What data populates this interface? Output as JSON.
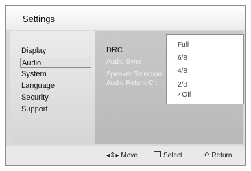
{
  "header": {
    "title": "Settings"
  },
  "sidebar": {
    "items": [
      {
        "label": "Display",
        "selected": false
      },
      {
        "label": "Audio",
        "selected": true
      },
      {
        "label": "System",
        "selected": false
      },
      {
        "label": "Language",
        "selected": false
      },
      {
        "label": "Security",
        "selected": false
      },
      {
        "label": "Support",
        "selected": false
      }
    ]
  },
  "submenu": {
    "items": [
      {
        "label": "DRC",
        "active": true
      },
      {
        "label": "Audio Sync",
        "active": false
      },
      {
        "label": "Speaker Selection",
        "active": false
      },
      {
        "label": "Audio Return Ch.",
        "active": false
      }
    ]
  },
  "drc_options": {
    "items": [
      "Full",
      "6/8",
      "4/8",
      "2/8",
      "Off"
    ],
    "checked": "Off",
    "check_glyph": "✓"
  },
  "footer": {
    "move_label": "Move",
    "move_glyph": "◂⇕▸",
    "select_label": "Select",
    "return_label": "Return",
    "return_glyph": "↶"
  },
  "colors": {
    "left_panel": "#e4e4e4",
    "right_panel": "#c2c2c2",
    "footer": "#e9e9e9"
  }
}
